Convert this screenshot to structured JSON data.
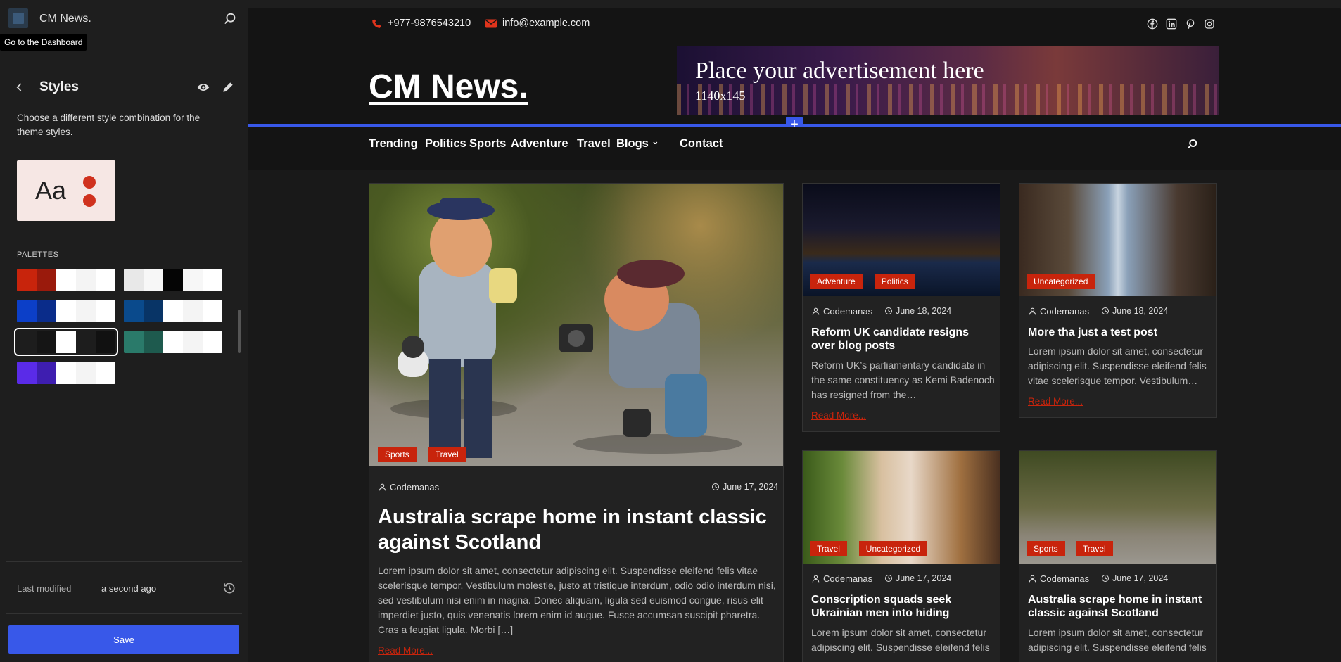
{
  "sidebar": {
    "site_title": "CM News.",
    "tooltip": "Go to the Dashboard",
    "styles_title": "Styles",
    "styles_desc": "Choose a different style combination for the theme styles.",
    "style_card_text": "Aa",
    "palettes_label": "PALETTES",
    "palettes": [
      {
        "colors": [
          "#c8240c",
          "#9a1a0c",
          "#ffffff",
          "#f4f4f4",
          "#ffffff"
        ]
      },
      {
        "colors": [
          "#e8e8e8",
          "#f7f7f7",
          "#050505",
          "#f7f7f7",
          "#ffffff"
        ]
      },
      {
        "colors": [
          "#0c3fc8",
          "#0a2c8a",
          "#ffffff",
          "#f4f4f4",
          "#ffffff"
        ]
      },
      {
        "colors": [
          "#0a4a8c",
          "#083466",
          "#ffffff",
          "#f4f4f4",
          "#ffffff"
        ]
      },
      {
        "colors": [
          "#1d1d1d",
          "#151515",
          "#ffffff",
          "#1d1d1d",
          "#111111"
        ]
      },
      {
        "colors": [
          "#2a7a6a",
          "#1e5a4e",
          "#ffffff",
          "#f4f4f4",
          "#ffffff"
        ]
      },
      {
        "colors": [
          "#5a2be8",
          "#3e1eb0",
          "#ffffff",
          "#f4f4f4",
          "#ffffff"
        ]
      }
    ],
    "last_modified_label": "Last modified",
    "last_modified_value": "a second ago",
    "save_label": "Save"
  },
  "preview": {
    "phone": "+977-9876543210",
    "email": "info@example.com",
    "logo": "CM News.",
    "ad_title": "Place your advertisement here",
    "ad_size": "1140x145",
    "nav": [
      "Trending",
      "Politics",
      "Sports",
      "Adventure",
      "Travel",
      "Blogs",
      "Contact"
    ],
    "featured": {
      "tags": [
        "Sports",
        "Travel"
      ],
      "author": "Codemanas",
      "date": "June 17, 2024",
      "title": "Australia scrape home in instant classic against Scotland",
      "excerpt": "Lorem ipsum dolor sit amet, consectetur adipiscing elit. Suspendisse eleifend felis vitae scelerisque tempor. Vestibulum molestie, justo at tristique interdum, odio odio interdum nisi, sed vestibulum nisi enim in magna. Donec aliquam, ligula sed euismod congue, risus elit imperdiet justo, quis venenatis lorem enim id augue. Fusce accumsan suscipit pharetra. Cras a feugiat ligula. Morbi […]",
      "read_more": "Read More..."
    },
    "cards": [
      {
        "tags": [
          "Adventure",
          "Politics"
        ],
        "author": "Codemanas",
        "date": "June 18, 2024",
        "title": "Reform UK candidate resigns over blog posts",
        "excerpt": "Reform UK’s parliamentary candidate in the same constituency as Kemi Badenoch has resigned from the…",
        "read_more": "Read More..."
      },
      {
        "tags": [
          "Uncategorized"
        ],
        "author": "Codemanas",
        "date": "June 18, 2024",
        "title": "More tha just a test post",
        "excerpt": "Lorem ipsum dolor sit amet, consectetur adipiscing elit. Suspendisse eleifend felis vitae scelerisque tempor. Vestibulum…",
        "read_more": "Read More..."
      },
      {
        "tags": [
          "Travel",
          "Uncategorized"
        ],
        "author": "Codemanas",
        "date": "June 17, 2024",
        "title": "Conscription squads seek Ukrainian men into hiding",
        "excerpt": "Lorem ipsum dolor sit amet, consectetur adipiscing elit. Suspendisse eleifend felis"
      },
      {
        "tags": [
          "Sports",
          "Travel"
        ],
        "author": "Codemanas",
        "date": "June 17, 2024",
        "title": "Australia scrape home in instant classic against Scotland",
        "excerpt": "Lorem ipsum dolor sit amet, consectetur adipiscing elit. Suspendisse eleifend felis"
      }
    ]
  }
}
